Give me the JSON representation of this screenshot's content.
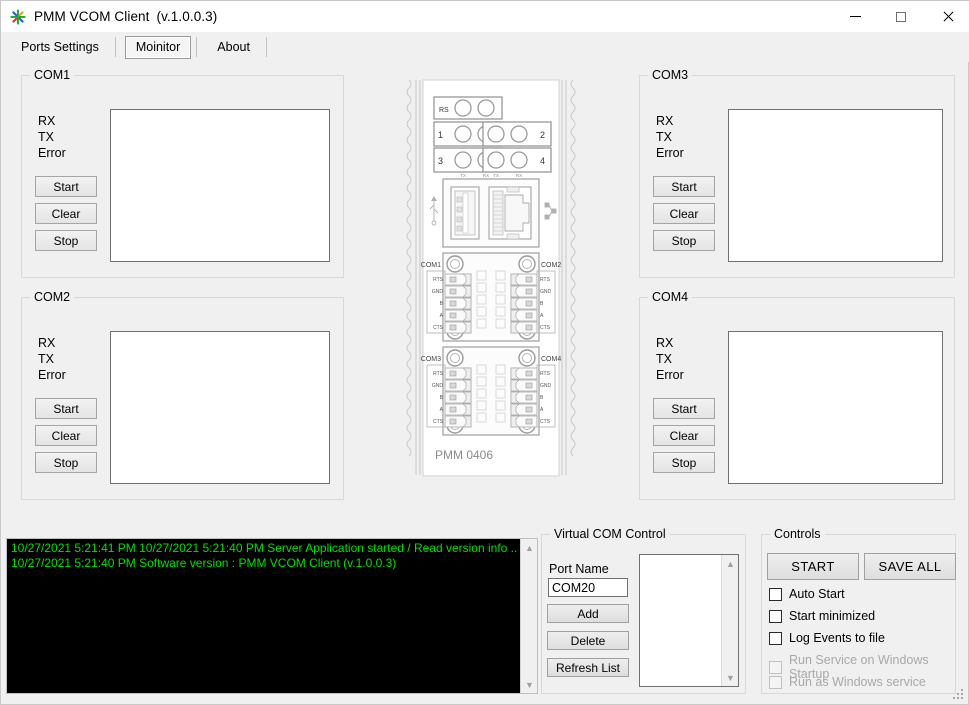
{
  "window": {
    "title": "PMM VCOM Client",
    "version": "(v.1.0.0.3)",
    "icon": "starburst-icon",
    "minimize_label": "Minimize",
    "maximize_label": "Maximize",
    "close_label": "Close"
  },
  "tabs": [
    {
      "label": "Ports Settings",
      "active": false
    },
    {
      "label": "Moinitor",
      "active": true
    },
    {
      "label": "About",
      "active": false
    }
  ],
  "com_panels": [
    {
      "title": "COM1",
      "signals": [
        "RX",
        "TX",
        "Error"
      ],
      "buttons": [
        "Start",
        "Clear",
        "Stop"
      ],
      "display_text": ""
    },
    {
      "title": "COM2",
      "signals": [
        "RX",
        "TX",
        "Error"
      ],
      "buttons": [
        "Start",
        "Clear",
        "Stop"
      ],
      "display_text": ""
    },
    {
      "title": "COM3",
      "signals": [
        "RX",
        "TX",
        "Error"
      ],
      "buttons": [
        "Start",
        "Clear",
        "Stop"
      ],
      "display_text": ""
    },
    {
      "title": "COM4",
      "signals": [
        "RX",
        "TX",
        "Error"
      ],
      "buttons": [
        "Start",
        "Clear",
        "Stop"
      ],
      "display_text": ""
    }
  ],
  "device": {
    "model_label": "PMM 0406",
    "led_rs_label": "RS",
    "led_numbers": [
      "1",
      "2",
      "3",
      "4"
    ],
    "led_sub_labels": [
      "TX",
      "RX"
    ],
    "port_labels_left": [
      "COM1",
      "COM3"
    ],
    "port_labels_right": [
      "COM2",
      "COM4"
    ],
    "terminal_labels": [
      "RTS",
      "GND",
      "B",
      "A",
      "CTS"
    ],
    "usb_icon": "usb-icon",
    "lan_icon": "lan-icon"
  },
  "log": {
    "lines": [
      "10/27/2021 5:21:41 PM 10/27/2021 5:21:40 PM Server Application started / Read version info ..",
      "10/27/2021 5:21:40 PM Software version : PMM VCOM Client  (v.1.0.0.3)"
    ],
    "text_color": "#00e000",
    "background_color": "#000000"
  },
  "virtual_com": {
    "title": "Virtual COM Control",
    "port_name_label": "Port Name",
    "port_name_value": "COM20",
    "port_name_placeholder": "",
    "buttons": [
      "Add",
      "Delete",
      "Refresh List"
    ],
    "list_items": []
  },
  "controls": {
    "title": "Controls",
    "start_label": "START",
    "save_all_label": "SAVE ALL",
    "checkboxes": [
      {
        "label": "Auto Start",
        "checked": false,
        "disabled": false
      },
      {
        "label": "Start minimized",
        "checked": false,
        "disabled": false
      },
      {
        "label": "Log Events to file",
        "checked": false,
        "disabled": false
      },
      {
        "label": "Run Service on Windows Startup",
        "checked": false,
        "disabled": true
      },
      {
        "label": "Run as Windows service",
        "checked": false,
        "disabled": true
      }
    ]
  },
  "colors": {
    "window_bg": "#f0f0f0",
    "titlebar_bg": "#ffffff",
    "group_border": "#d8d8d8",
    "button_face": "#eeeeee",
    "console_green": "#00e000"
  }
}
